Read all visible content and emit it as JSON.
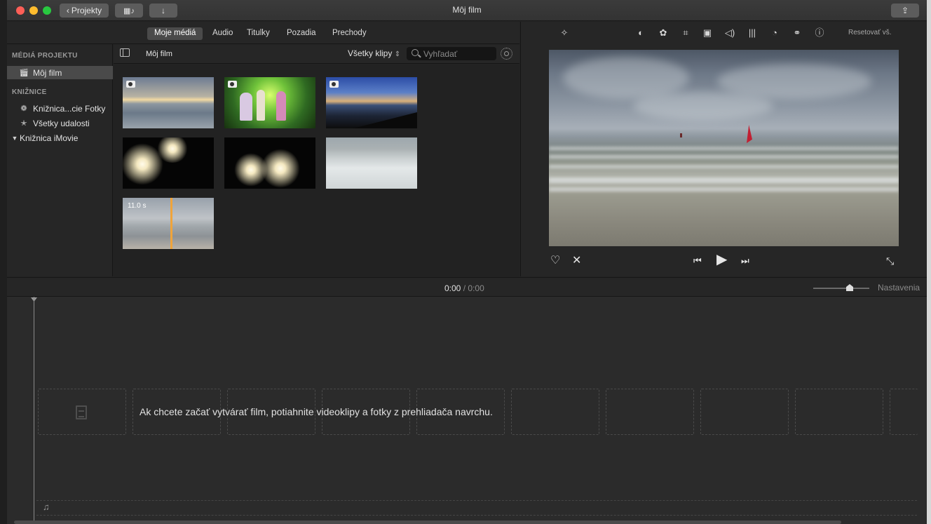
{
  "window": {
    "title": "Môj film",
    "projects_button": "Projekty"
  },
  "browser": {
    "tabs": [
      "Moje médiá",
      "Audio",
      "Titulky",
      "Pozadia",
      "Prechody"
    ],
    "active_tab": "Moje médiá",
    "title": "Môj film",
    "clips_filter": "Všetky klipy",
    "search_placeholder": "Vyhľadať"
  },
  "sidebar": {
    "project_media_header": "MÉDIÁ PROJEKTU",
    "project_item": "Môj film",
    "libraries_header": "KNIŽNICE",
    "libraries": [
      {
        "label": "Knižnica...cie Fotky",
        "icon": "photos-library-icon"
      },
      {
        "label": "Všetky udalosti",
        "icon": "star-icon"
      },
      {
        "label": "Knižnica iMovie",
        "icon": "disclosure-triangle-icon"
      }
    ]
  },
  "clips": [
    {
      "kind": "photo",
      "subject": "sunset sea"
    },
    {
      "kind": "photo",
      "subject": "stage concert"
    },
    {
      "kind": "photo",
      "subject": "blue dusk coast"
    },
    {
      "kind": "video",
      "subject": "fireworks"
    },
    {
      "kind": "video",
      "subject": "fireworks"
    },
    {
      "kind": "video",
      "subject": "waves"
    },
    {
      "kind": "video",
      "subject": "beach",
      "duration": "11.0 s"
    }
  ],
  "viewer": {
    "reset_all": "Resetovať vš.",
    "adjust_icons": [
      "magic-wand-icon",
      "color-balance-icon",
      "color-correction-icon",
      "crop-icon",
      "stabilization-icon",
      "volume-icon",
      "equalizer-icon",
      "speed-icon",
      "clip-filter-icon",
      "info-icon"
    ]
  },
  "timeline": {
    "current_time": "0:00",
    "separator": "/",
    "total_time": "0:00",
    "settings_label": "Nastavenia",
    "zoom_level": 0.65,
    "hint": "Ak chcete začať vytvárať film, potiahnite videoklipy a fotky z prehliadača navrchu."
  },
  "colors": {
    "accent_playhead": "#f0a43a",
    "close": "#fe5f57",
    "minimize": "#febc2e",
    "zoom": "#28c840"
  }
}
